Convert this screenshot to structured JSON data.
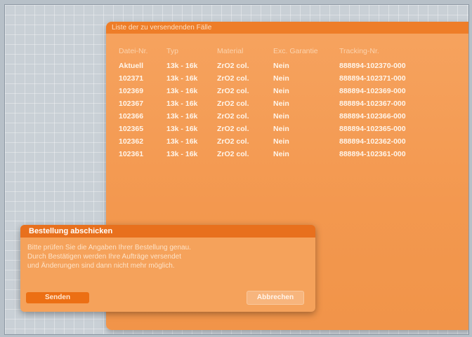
{
  "panel": {
    "header": "Liste der zu versendenden Fälle",
    "columns": [
      "Datei-Nr.",
      "Typ",
      "Material",
      "Exc. Garantie",
      "Tracking-Nr."
    ],
    "rows": [
      [
        "Aktuell",
        "13k - 16k",
        "ZrO2 col.",
        "Nein",
        "888894-102370-000"
      ],
      [
        "102371",
        "13k - 16k",
        "ZrO2 col.",
        "Nein",
        "888894-102371-000"
      ],
      [
        "102369",
        "13k - 16k",
        "ZrO2 col.",
        "Nein",
        "888894-102369-000"
      ],
      [
        "102367",
        "13k - 16k",
        "ZrO2 col.",
        "Nein",
        "888894-102367-000"
      ],
      [
        "102366",
        "13k - 16k",
        "ZrO2 col.",
        "Nein",
        "888894-102366-000"
      ],
      [
        "102365",
        "13k - 16k",
        "ZrO2 col.",
        "Nein",
        "888894-102365-000"
      ],
      [
        "102362",
        "13k - 16k",
        "ZrO2 col.",
        "Nein",
        "888894-102362-000"
      ],
      [
        "102361",
        "13k - 16k",
        "ZrO2 col.",
        "Nein",
        "888894-102361-000"
      ]
    ]
  },
  "dialog": {
    "title": "Bestellung abschicken",
    "lines": [
      "Bitte prüfen Sie die Angaben Ihrer Bestellung genau.",
      "Durch Bestätigen werden Ihre Aufträge versendet",
      "und Änderungen sind dann nicht mehr möglich."
    ],
    "send_label": "Senden",
    "cancel_label": "Abbrechen"
  }
}
